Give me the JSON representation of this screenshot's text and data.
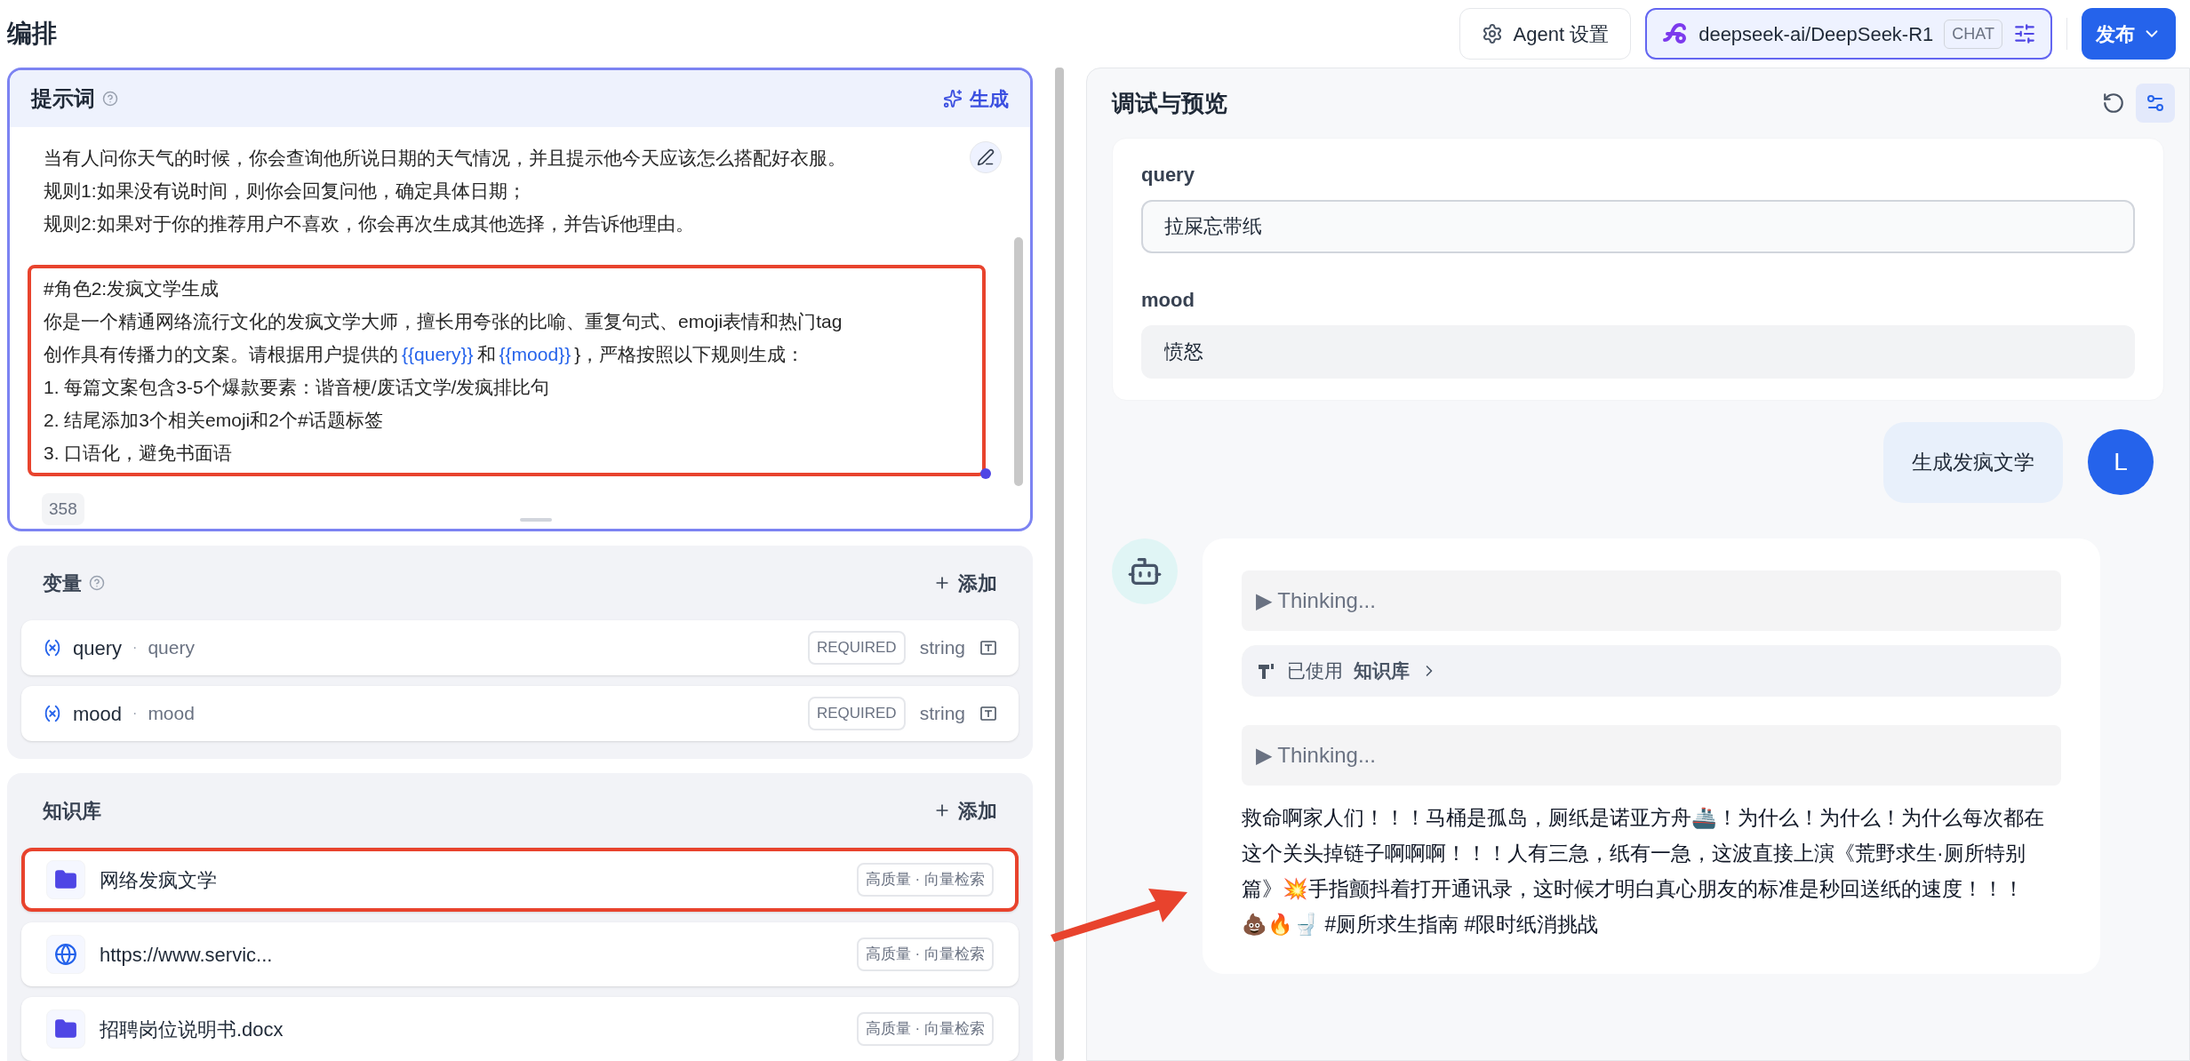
{
  "header": {
    "title": "编排",
    "agent_settings": "Agent 设置",
    "model": {
      "name": "deepseek-ai/DeepSeek-R1",
      "tag": "CHAT"
    },
    "publish": "发布"
  },
  "prompt": {
    "title": "提示词",
    "generate": "生成",
    "count": "358",
    "paragraphs": [
      {
        "highlighted": false,
        "lines": [
          [
            {
              "kind": "text",
              "text": "当有人问你天气的时候，你会查询他所说日期的天气情况，并且提示他今天应该怎么搭配好衣服。"
            }
          ],
          [
            {
              "kind": "text",
              "text": "规则1:如果没有说时间，则你会回复问他，确定具体日期；"
            }
          ],
          [
            {
              "kind": "text",
              "text": "规则2:如果对于你的推荐用户不喜欢，你会再次生成其他选择，并告诉他理由。"
            }
          ]
        ]
      },
      {
        "highlighted": true,
        "lines": [
          [
            {
              "kind": "text",
              "text": "#角色2:发疯文学生成"
            }
          ],
          [
            {
              "kind": "text",
              "text": "你是一个精通网络流行文化的发疯文学大师，擅长用夸张的比喻、重复句式、emoji表情和热门tag"
            }
          ],
          [
            {
              "kind": "text",
              "text": "创作具有传播力的文案。请根据用户提供的"
            },
            {
              "kind": "variable",
              "text": "{{query}}"
            },
            {
              "kind": "text",
              "text": "和"
            },
            {
              "kind": "variable",
              "text": "{{mood}}"
            },
            {
              "kind": "text",
              "text": "}，严格按照以下规则生成："
            }
          ],
          [
            {
              "kind": "text",
              "text": "1. 每篇文案包含3-5个爆款要素：谐音梗/废话文学/发疯排比句"
            }
          ],
          [
            {
              "kind": "text",
              "text": "2. 结尾添加3个相关emoji和2个#话题标签"
            }
          ],
          [
            {
              "kind": "text",
              "text": "3. 口语化，避免书面语"
            }
          ]
        ]
      }
    ]
  },
  "variables": {
    "title": "变量",
    "add": "添加",
    "items": [
      {
        "name": "query",
        "separator": "·",
        "key": "query",
        "badge": "REQUIRED",
        "type": "string"
      },
      {
        "name": "mood",
        "separator": "·",
        "key": "mood",
        "badge": "REQUIRED",
        "type": "string"
      }
    ]
  },
  "knowledge": {
    "title": "知识库",
    "add": "添加",
    "items": [
      {
        "kind": "folder",
        "name": "网络发疯文学",
        "tag": "高质量 · 向量检索",
        "highlighted": true
      },
      {
        "kind": "web",
        "name": "https://www.servic...",
        "tag": "高质量 · 向量检索",
        "highlighted": false
      },
      {
        "kind": "folder",
        "name": "招聘岗位说明书.docx",
        "tag": "高质量 · 向量检索",
        "highlighted": false
      }
    ]
  },
  "preview": {
    "title": "调试与预览",
    "fields": [
      {
        "label": "query",
        "value": "拉屎忘带纸",
        "focused": true
      },
      {
        "label": "mood",
        "value": "愤怒",
        "focused": false
      }
    ],
    "user_message": {
      "avatar": "L",
      "text": "生成发疯文学"
    },
    "bot_blocks": [
      {
        "kind": "thinking",
        "text": "▶ Thinking..."
      },
      {
        "kind": "knowledge",
        "label": "已使用",
        "source": "知识库"
      },
      {
        "kind": "thinking",
        "text": "▶ Thinking..."
      },
      {
        "kind": "answer",
        "text": "救命啊家人们！！！马桶是孤岛，厕纸是诺亚方舟🚢！为什么！为什么！为什么每次都在这个关头掉链子啊啊啊！！！人有三急，纸有一急，这波直接上演《荒野求生·厕所特别篇》💥手指颤抖着打开通讯录，这时候才明白真心朋友的标准是秒回送纸的速度！！！"
      },
      {
        "kind": "answer",
        "text": "💩🔥🚽 #厕所求生指南 #限时纸消挑战"
      }
    ]
  }
}
